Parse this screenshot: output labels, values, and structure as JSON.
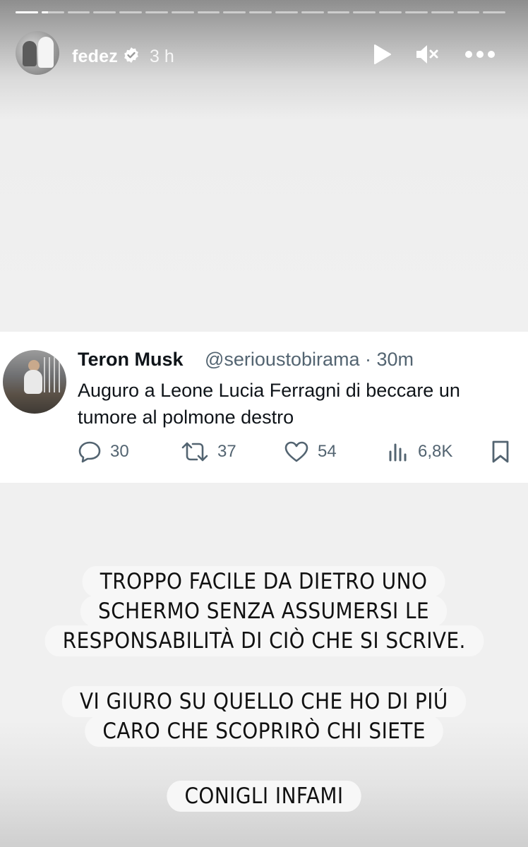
{
  "story": {
    "progress": {
      "segments": 19,
      "current_index": 1,
      "current_fraction": 0.3
    },
    "header": {
      "username": "fedez",
      "time": "3 h",
      "icons": [
        "avatar",
        "verified-badge-icon",
        "play-icon",
        "mute-icon",
        "more-icon"
      ]
    }
  },
  "tweet": {
    "display_name": "Teron Musk",
    "handle_time": "@serioustobirama · 30m",
    "text": "Auguro a Leone Lucia Ferragni di beccare un tumore al polmone destro",
    "actions": {
      "replies": "30",
      "retweets": "37",
      "likes": "54",
      "views": "6,8K"
    }
  },
  "caption": {
    "block1": {
      "line1": "TROPPO FACILE DA DIETRO UNO",
      "line2": "SCHERMO SENZA ASSUMERSI LE",
      "line3": "RESPONSABILITÀ DI CIÒ CHE SI SCRIVE."
    },
    "block2": {
      "line1": "VI GIURO SU QUELLO CHE HO DI PIÚ",
      "line2": "CARO CHE SCOPRIRÒ CHI SIETE"
    },
    "block3": {
      "line1": "CONIGLI INFAMI"
    }
  },
  "colors": {
    "text_primary": "#0f1419",
    "text_secondary": "#536471",
    "caption_bg": "#f7f7f7"
  }
}
